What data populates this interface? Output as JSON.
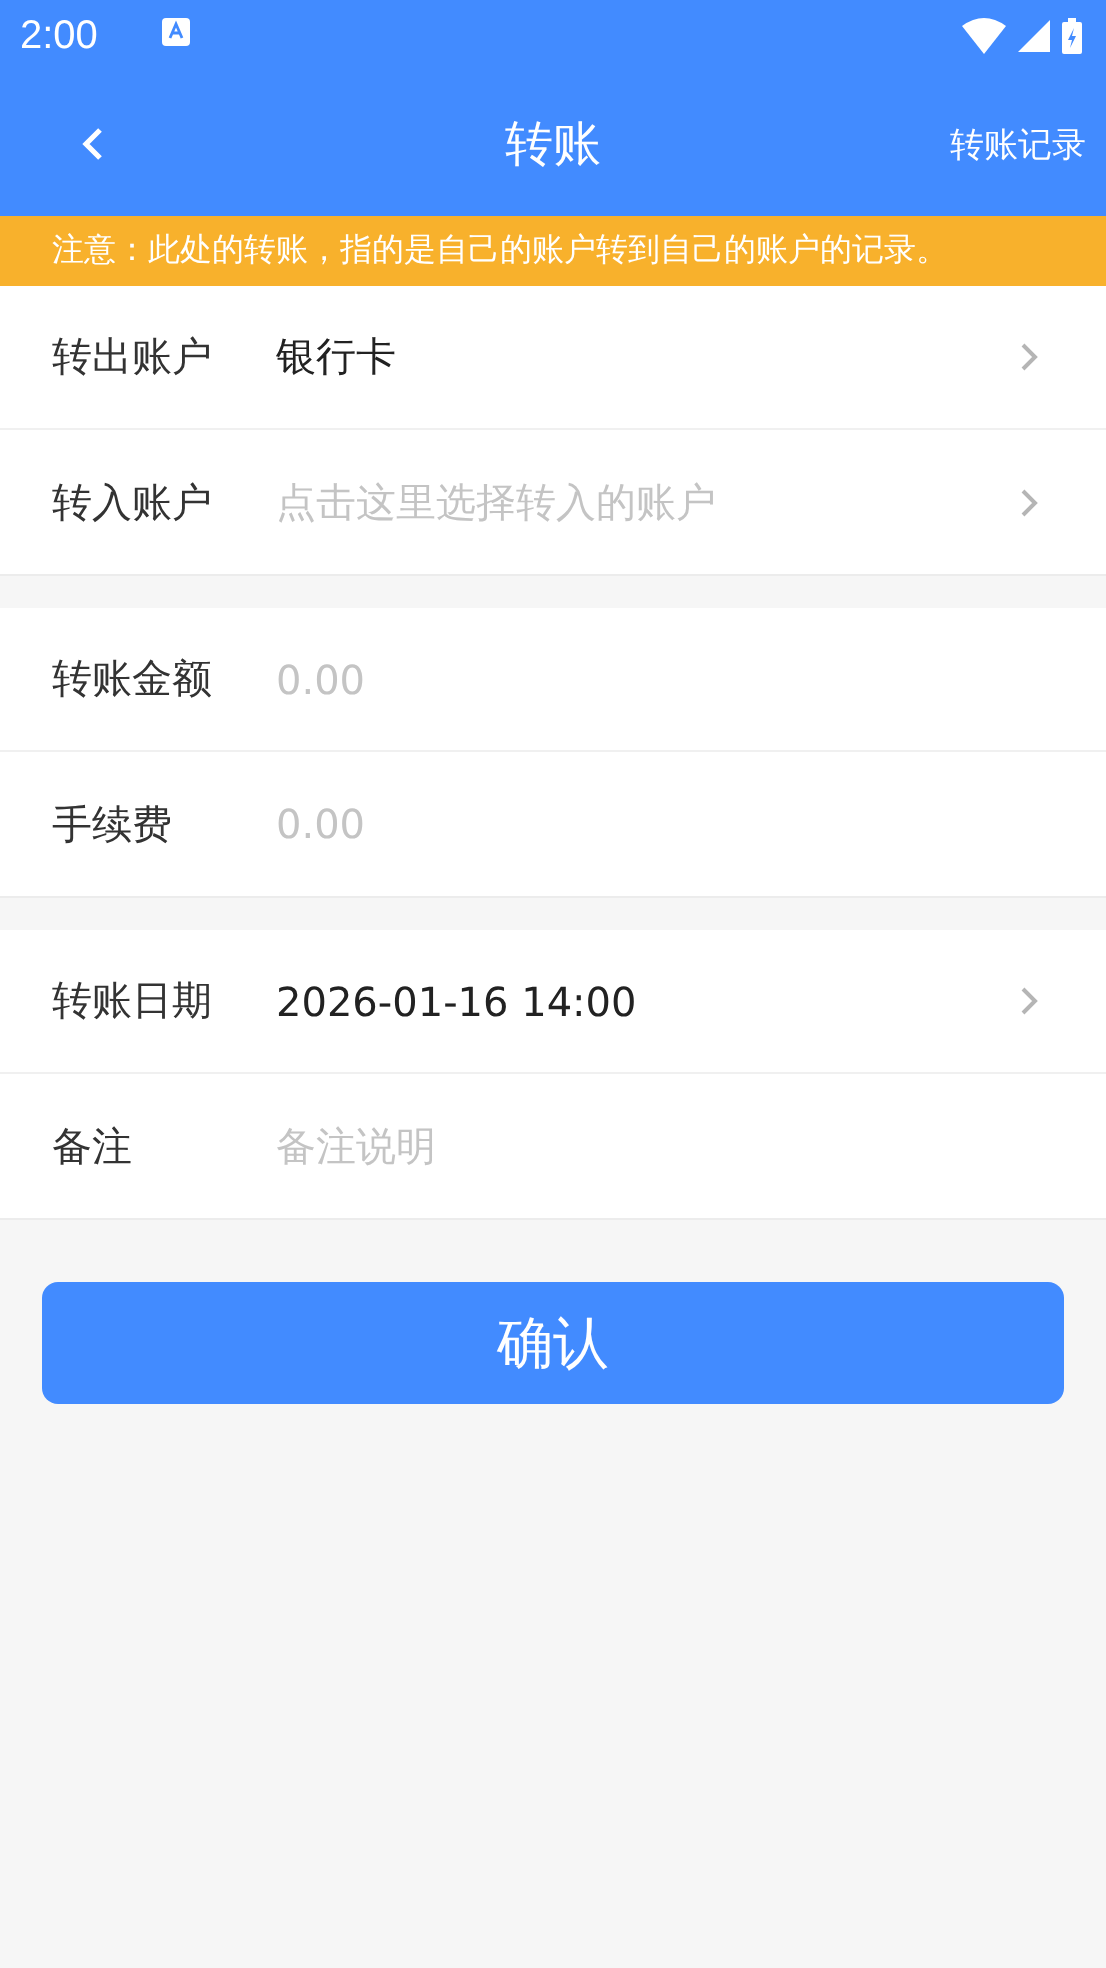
{
  "status_bar": {
    "time": "2:00"
  },
  "app_bar": {
    "title": "转账",
    "action": "转账记录"
  },
  "notice": "注意：此处的转账，指的是自己的账户转到自己的账户的记录。",
  "groups": [
    [
      {
        "kind": "select",
        "label": "转出账户",
        "value": "银行卡"
      },
      {
        "kind": "select",
        "label": "转入账户",
        "placeholder": "点击这里选择转入的账户"
      }
    ],
    [
      {
        "kind": "input",
        "label": "转账金额",
        "placeholder": "0.00"
      },
      {
        "kind": "input",
        "label": "手续费",
        "placeholder": "0.00"
      }
    ],
    [
      {
        "kind": "select",
        "label": "转账日期",
        "value": "2026-01-16 14:00"
      },
      {
        "kind": "input",
        "label": "备注",
        "placeholder": "备注说明"
      }
    ]
  ],
  "confirm_button": "确认"
}
